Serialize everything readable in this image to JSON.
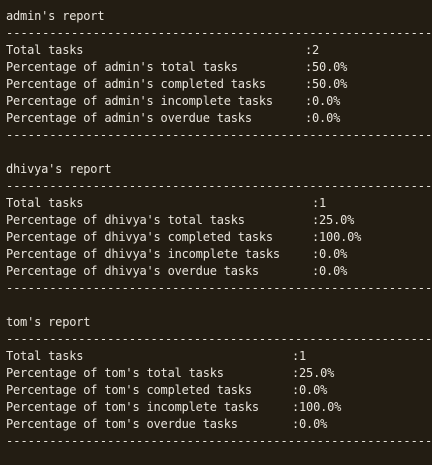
{
  "divider": "--------------------------------------------------------------",
  "reports": [
    {
      "title": "admin's report",
      "rows": [
        {
          "label": "Total tasks",
          "value": ":2"
        },
        {
          "label": "Percentage of admin's total tasks",
          "value": ":50.0%"
        },
        {
          "label": "Percentage of admin's completed tasks",
          "value": ":50.0%"
        },
        {
          "label": "Percentage of admin's incomplete tasks",
          "value": ":0.0%"
        },
        {
          "label": "Percentage of admin's overdue tasks",
          "value": ":0.0%"
        }
      ]
    },
    {
      "title": "dhivya's report",
      "rows": [
        {
          "label": "Total tasks",
          "value": ":1"
        },
        {
          "label": "Percentage of dhivya's total tasks",
          "value": ":25.0%"
        },
        {
          "label": "Percentage of dhivya's completed tasks",
          "value": ":100.0%"
        },
        {
          "label": "Percentage of dhivya's incomplete tasks",
          "value": ":0.0%"
        },
        {
          "label": "Percentage of dhivya's overdue tasks",
          "value": ":0.0%"
        }
      ]
    },
    {
      "title": "tom's report",
      "rows": [
        {
          "label": "Total tasks",
          "value": ":1"
        },
        {
          "label": "Percentage of tom's total tasks",
          "value": ":25.0%"
        },
        {
          "label": "Percentage of tom's completed tasks",
          "value": ":0.0%"
        },
        {
          "label": "Percentage of tom's incomplete tasks",
          "value": ":100.0%"
        },
        {
          "label": "Percentage of tom's overdue tasks",
          "value": ":0.0%"
        }
      ]
    }
  ]
}
